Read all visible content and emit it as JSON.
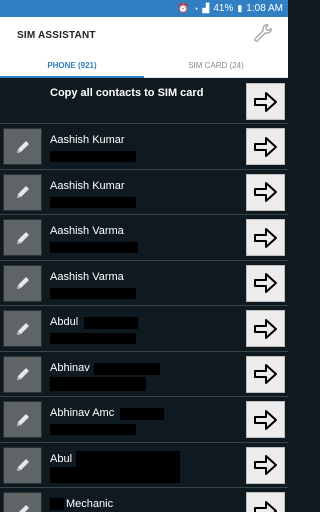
{
  "status": {
    "battery": "41%",
    "time": "1:08 AM"
  },
  "app": {
    "title": "SIM ASSISTANT",
    "settings_icon": "wrench-icon"
  },
  "tabs": [
    {
      "label": "PHONE (921)",
      "active": true
    },
    {
      "label": "SIM CARD (24)",
      "active": false
    }
  ],
  "copy_all_label": "Copy all contacts to SIM card",
  "contacts": [
    {
      "name": "Aashish Kumar"
    },
    {
      "name": "Aashish Kumar"
    },
    {
      "name": "Aashish Varma"
    },
    {
      "name": "Aashish Varma"
    },
    {
      "name": "Abdul"
    },
    {
      "name": "Abhinav"
    },
    {
      "name": "Abhinav Amc"
    },
    {
      "name": "Abul"
    },
    {
      "name": "Mechanic"
    }
  ],
  "colors": {
    "accent": "#2f7fc2",
    "background": "#0f1a20"
  }
}
